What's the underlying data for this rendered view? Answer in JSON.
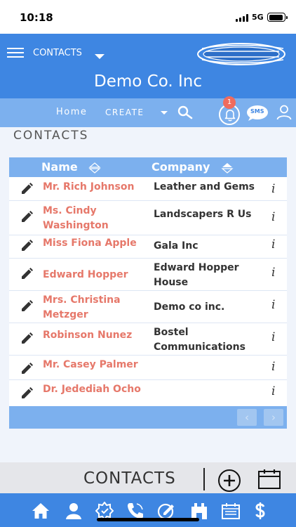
{
  "status_bar": {
    "time": "10:18",
    "network": "5G"
  },
  "header": {
    "menu_label": "CONTACTS",
    "company": "Demo Co. Inc"
  },
  "nav": {
    "home": "Home",
    "create": "CREATE",
    "notification_count": "1",
    "sms": "SMS"
  },
  "section_title": "CONTACTS",
  "table": {
    "columns": [
      "Name",
      "Company"
    ],
    "rows": [
      {
        "name": "Mr. Rich Johnson",
        "company": "Leather and Gems"
      },
      {
        "name": "Ms. Cindy Washington",
        "company": "Landscapers R Us"
      },
      {
        "name": "Miss Fiona Apple",
        "company": "Gala Inc"
      },
      {
        "name": "Edward Hopper",
        "company": "Edward Hopper House"
      },
      {
        "name": "Mrs. Christina Metzger",
        "company": "Demo co inc."
      },
      {
        "name": "Robinson Nunez",
        "company": "Bostel Communications"
      },
      {
        "name": "Mr. Casey Palmer",
        "company": ""
      },
      {
        "name": "Dr. Jedediah Ocho",
        "company": ""
      }
    ],
    "info_glyph": "i"
  },
  "pager": {
    "prev": "‹",
    "next": "›"
  },
  "bottom": {
    "title": "CONTACTS"
  },
  "colors": {
    "primary": "#3e86e2",
    "secondary": "#7cb0ee",
    "name_text": "#e6786a",
    "badge": "#ef6b5e"
  },
  "tab_icons": [
    "home-icon",
    "person-icon",
    "badge-icon",
    "phone-icon",
    "edit-icon",
    "building-icon",
    "calendar-list-icon",
    "dollar-icon"
  ]
}
